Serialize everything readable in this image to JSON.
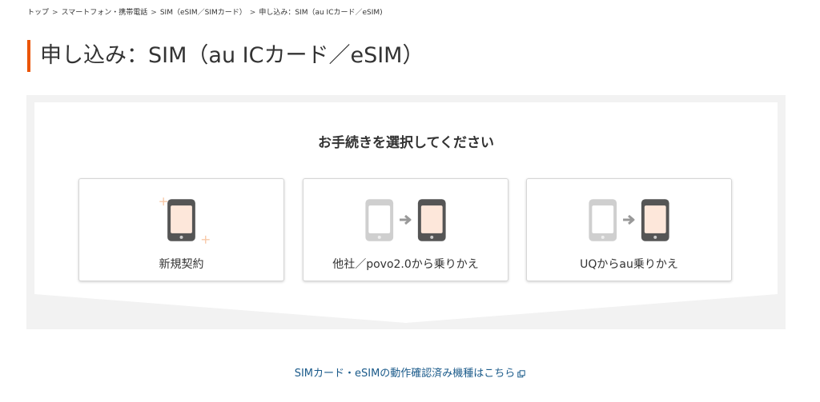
{
  "breadcrumb": {
    "items": [
      "トップ",
      "スマートフォン・携帯電話",
      "SIM（eSIM／SIMカード）",
      "申し込み：SIM（au ICカード／eSIM)"
    ],
    "separator": ">"
  },
  "page_title": "申し込み：SIM（au ICカード／eSIM）",
  "selector": {
    "heading": "お手続きを選択してください",
    "options": [
      {
        "label": "新規契約",
        "icon": "phone-icon"
      },
      {
        "label": "他社／povo2.0から乗りかえ",
        "icon": "phone-transfer-icon"
      },
      {
        "label": "UQからau乗りかえ",
        "icon": "phone-transfer-icon"
      }
    ]
  },
  "footer_link": {
    "label": "SIMカード・eSIMの動作確認済み機種はこちら",
    "icon": "external-link-icon"
  },
  "colors": {
    "accent": "#eb5505",
    "phone_body": "#555555",
    "phone_screen": "#fde7da",
    "phone_old": "#cccccc",
    "arrow": "#999999",
    "link": "#1a5a8a",
    "panel_bg": "#f2f2f2"
  }
}
